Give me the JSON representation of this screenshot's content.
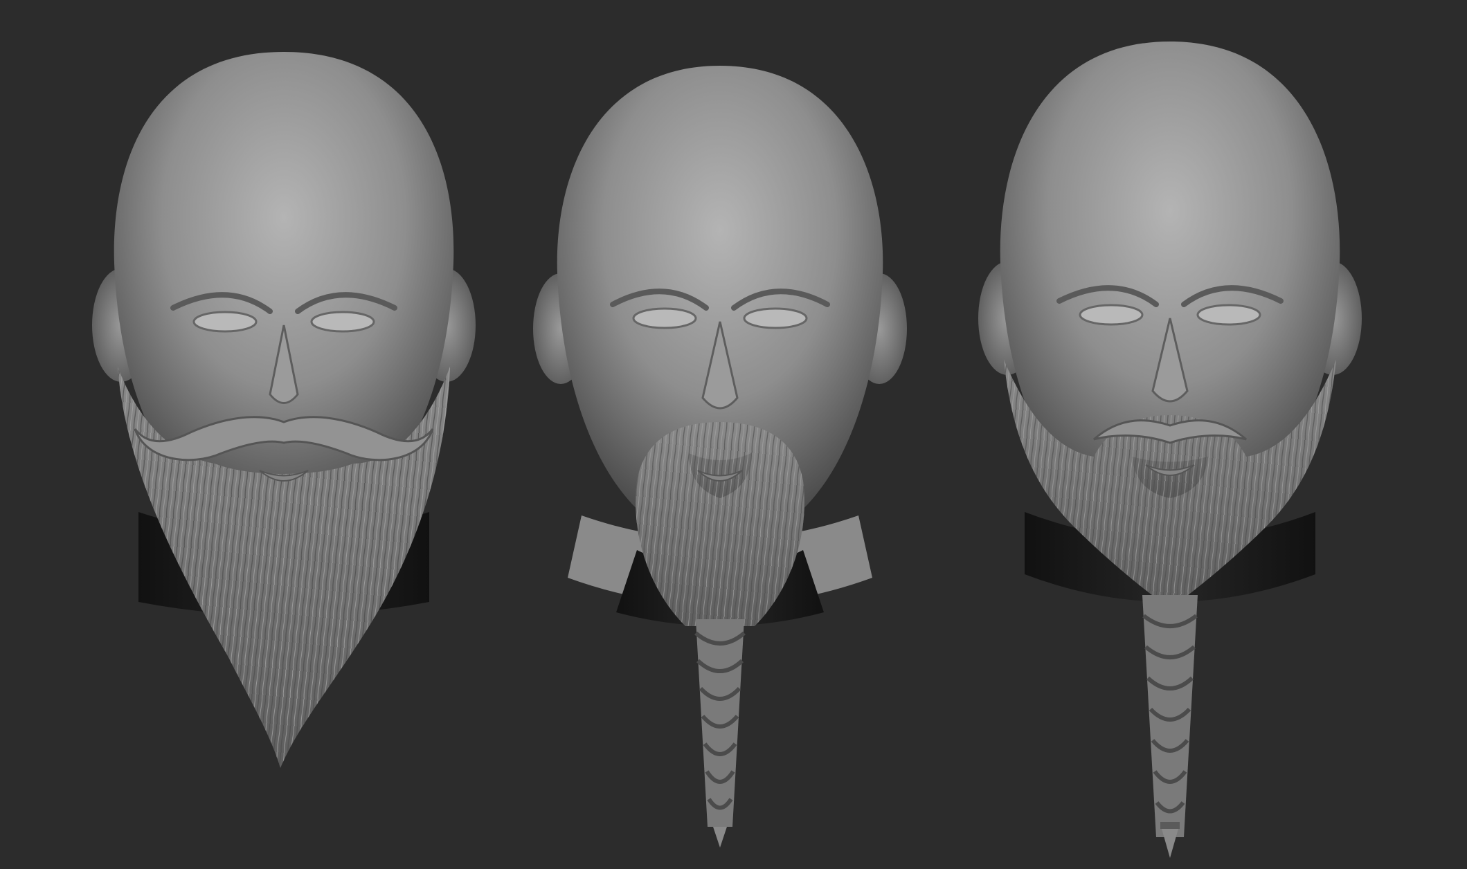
{
  "scene": {
    "background_color": "#2c2c2c",
    "clay_color": "#8d8d8d",
    "collar_color": "#1d1d1d",
    "heads": [
      {
        "id": "head-1",
        "beard_style": "long-pointed-beard-with-curled-moustache"
      },
      {
        "id": "head-2",
        "beard_style": "goatee-with-single-braid"
      },
      {
        "id": "head-3",
        "beard_style": "full-beard-with-braid"
      }
    ]
  }
}
